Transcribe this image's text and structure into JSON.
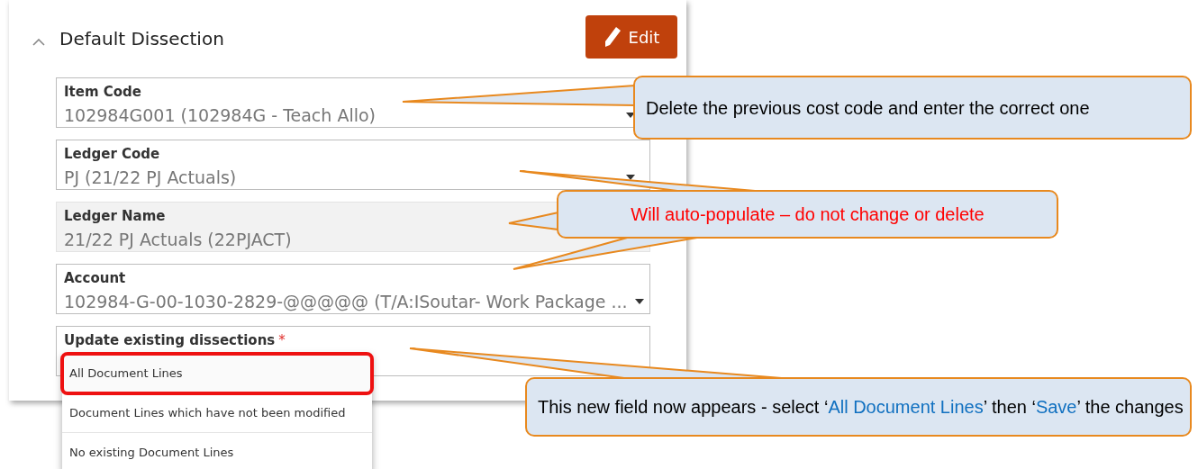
{
  "panel": {
    "title": "Default Dissection",
    "expanded": true,
    "edit_button": "Edit",
    "fields": [
      {
        "kind": "select",
        "label": "Item Code",
        "value": "102984G001 (102984G - Teach Allo)"
      },
      {
        "kind": "select",
        "label": "Ledger Code",
        "value": "PJ (21/22 PJ Actuals)"
      },
      {
        "kind": "readonly",
        "label": "Ledger Name",
        "value": "21/22 PJ Actuals (22PJACT)"
      },
      {
        "kind": "select",
        "label": "Account",
        "value": "102984-G-00-1030-2829-@@@@@ (T/A:ISoutar- Work Package ..."
      },
      {
        "kind": "open",
        "label": "Update existing dissections",
        "required": "*",
        "options": [
          {
            "label": "All Document Lines",
            "selected": true
          },
          {
            "label": "Document Lines which have not been modified",
            "selected": false
          },
          {
            "label": "No existing Document Lines",
            "selected": false
          }
        ]
      }
    ]
  },
  "annotations": [
    {
      "kind": "note",
      "segments": [
        {
          "kind": "plain",
          "text": "Delete the previous cost code and enter the correct one"
        }
      ]
    },
    {
      "kind": "warning",
      "segments": [
        {
          "kind": "plain",
          "text": "Will auto-populate – do not change or delete"
        }
      ]
    },
    {
      "kind": "note",
      "segments": [
        {
          "kind": "plain",
          "text": "This new field now appears - select ‘"
        },
        {
          "kind": "highlight",
          "text": "All Document Lines"
        },
        {
          "kind": "plain",
          "text": "’ then ‘"
        },
        {
          "kind": "highlight",
          "text": "Save"
        },
        {
          "kind": "plain",
          "text": "’ the changes"
        }
      ]
    }
  ]
}
